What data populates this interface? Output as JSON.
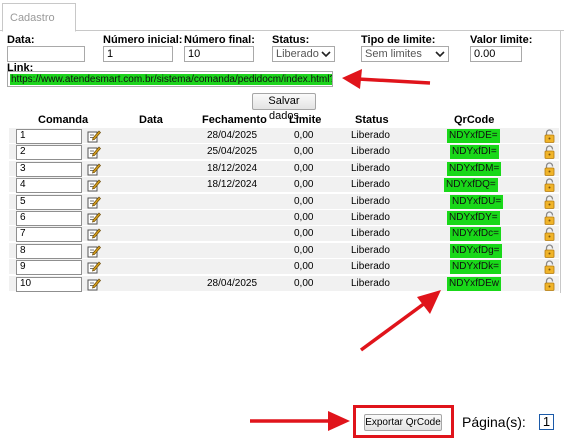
{
  "tabs": [
    {
      "label": "Cadastro"
    }
  ],
  "form": {
    "data_label": "Data:",
    "data_value": "",
    "numero_inicial_label": "Número inicial:",
    "numero_inicial_value": "1",
    "numero_final_label": "Número final:",
    "numero_final_value": "10",
    "status_label": "Status:",
    "status_value": "Liberado",
    "tipo_limite_label": "Tipo de limite:",
    "tipo_limite_value": "Sem limites",
    "valor_limite_label": "Valor limite:",
    "valor_limite_value": "0.00",
    "link_label": "Link:",
    "link_value": "https://www.atendesmart.com.br/sistema/comanda/pedidocm/index.html?id=",
    "salvar_label": "Salvar dados"
  },
  "table": {
    "columns": [
      "Comanda",
      "Data",
      "Fechamento",
      "Limite",
      "Status",
      "QrCode"
    ],
    "rows": [
      {
        "comanda": "1",
        "data": "",
        "fechamento": "28/04/2025",
        "limite": "0,00",
        "status": "Liberado",
        "qrcode": "NDYxfDE="
      },
      {
        "comanda": "2",
        "data": "",
        "fechamento": "25/04/2025",
        "limite": "0,00",
        "status": "Liberado",
        "qrcode": "NDYxfDI="
      },
      {
        "comanda": "3",
        "data": "",
        "fechamento": "18/12/2024",
        "limite": "0,00",
        "status": "Liberado",
        "qrcode": "NDYxfDM="
      },
      {
        "comanda": "4",
        "data": "",
        "fechamento": "18/12/2024",
        "limite": "0,00",
        "status": "Liberado",
        "qrcode": "NDYxfDQ="
      },
      {
        "comanda": "5",
        "data": "",
        "fechamento": "",
        "limite": "0,00",
        "status": "Liberado",
        "qrcode": "NDYxfDU="
      },
      {
        "comanda": "6",
        "data": "",
        "fechamento": "",
        "limite": "0,00",
        "status": "Liberado",
        "qrcode": "NDYxfDY="
      },
      {
        "comanda": "7",
        "data": "",
        "fechamento": "",
        "limite": "0,00",
        "status": "Liberado",
        "qrcode": "NDYxfDc="
      },
      {
        "comanda": "8",
        "data": "",
        "fechamento": "",
        "limite": "0,00",
        "status": "Liberado",
        "qrcode": "NDYxfDg="
      },
      {
        "comanda": "9",
        "data": "",
        "fechamento": "",
        "limite": "0,00",
        "status": "Liberado",
        "qrcode": "NDYxfDk="
      },
      {
        "comanda": "10",
        "data": "",
        "fechamento": "28/04/2025",
        "limite": "0,00",
        "status": "Liberado",
        "qrcode": "NDYxfDEw"
      }
    ]
  },
  "footer": {
    "export_label": "Exportar QrCode",
    "pagina_label": "Página(s):",
    "current_page": "1"
  },
  "colors": {
    "highlight": "#19d819",
    "annotation": "#e0141b",
    "page_border": "#1b5aa8"
  },
  "icons": {
    "edit": "edit-icon",
    "lock": "lock-icon",
    "select": "chevron-down-icon"
  }
}
